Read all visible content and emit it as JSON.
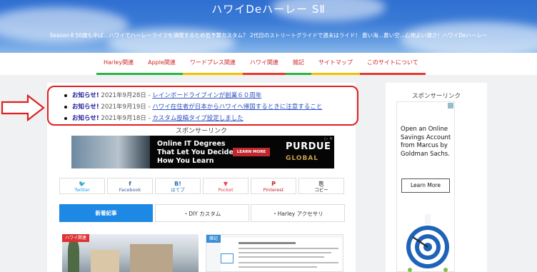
{
  "header": {
    "title": "ハワイDeハーレー SⅡ",
    "description": "Season-Ⅱ 50歳も半ば…ハワイでハーレーライフを満喫するため低予算カスタム？ 2代目のストリートグライドで週末はライド！ 蒼い海…蒼い空…心地よい潮さ！ハワイDeハーレー"
  },
  "nav": {
    "items": [
      {
        "label": "Harley関連",
        "bar": "#2bb34a"
      },
      {
        "label": "Apple関連",
        "bar": "#2bb34a"
      },
      {
        "label": "ワードプレス関連",
        "bar": "#f2c200"
      },
      {
        "label": "ハワイ関連",
        "bar": "#e63b2e"
      },
      {
        "label": "雑記",
        "bar": "#2bb34a"
      },
      {
        "label": "サイトマップ",
        "bar": "#f2c200"
      },
      {
        "label": "このサイトについて",
        "bar": "#e63b2e"
      }
    ]
  },
  "notices": [
    {
      "label": "お知らせ!",
      "date": "2021年9月28日 -",
      "title": "レインボードライブインが創業６０周年"
    },
    {
      "label": "お知らせ!",
      "date": "2021年9月19日 -",
      "title": "ハワイ在住者が日本からハワイへ帰国するときに注意すること"
    },
    {
      "label": "お知らせ!",
      "date": "2021年9月18日 -",
      "title": "カスタム投稿タイプ設定しました"
    }
  ],
  "sponsor": {
    "main_title": "スポンサーリンク",
    "side_title": "スポンサーリンク"
  },
  "ad_banner": {
    "text_line1": "Online IT Degrees",
    "text_line2": "That Let You Decide",
    "text_line3": "How You Learn",
    "button": "LEARN MORE",
    "brand": "PURDUE",
    "brand_sub": "GLOBAL",
    "close": "▷ ✕"
  },
  "share": [
    {
      "icon": "🐦",
      "label": "Twitter",
      "color": "#1da1f2",
      "icon_name": "twitter-icon"
    },
    {
      "icon": "f",
      "label": "Facebook",
      "color": "#3b5998",
      "icon_name": "facebook-icon"
    },
    {
      "icon": "B!",
      "label": "はてブ",
      "color": "#2c6ebd",
      "icon_name": "hatena-icon"
    },
    {
      "icon": "▼",
      "label": "Pocket",
      "color": "#ef4056",
      "icon_name": "pocket-icon"
    },
    {
      "icon": "P",
      "label": "Pinterest",
      "color": "#cb2027",
      "icon_name": "pinterest-icon"
    },
    {
      "icon": "⎘",
      "label": "コピー",
      "color": "#333333",
      "icon_name": "copy-icon"
    }
  ],
  "tabs": [
    {
      "label": "新着記事",
      "active": true
    },
    {
      "label": "・DIY カスタム",
      "active": false
    },
    {
      "label": "・Harley アクセサリ",
      "active": false
    }
  ],
  "cards": [
    {
      "tag": "ハワイ関連",
      "tag_color": "#d33"
    },
    {
      "tag": "雑記",
      "tag_color": "#3a8ed8"
    }
  ],
  "side_ad": {
    "text": "Open an Online Savings Account from Marcus by Goldman Sachs.",
    "button": "Learn More"
  },
  "colors": {
    "accent_red": "#e02020",
    "nav_text": "#d02525",
    "tab_active": "#1e88e5"
  }
}
